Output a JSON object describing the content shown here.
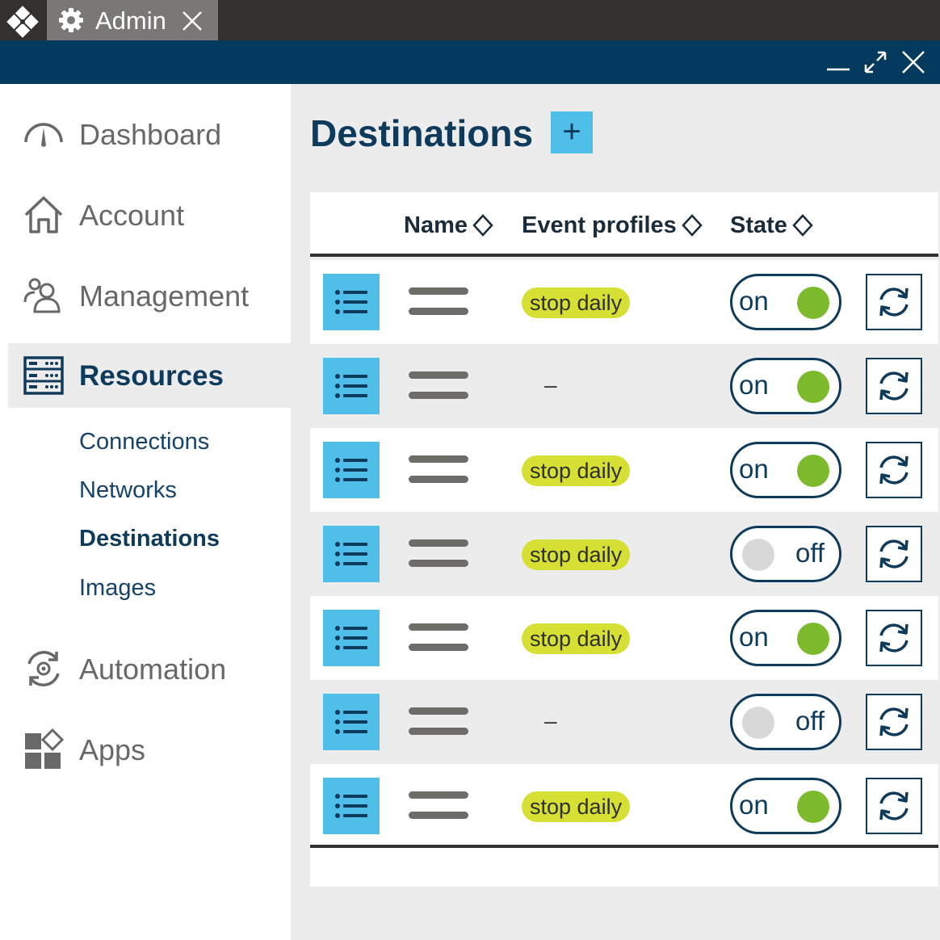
{
  "tab": {
    "label": "Admin"
  },
  "sidebar": {
    "items": [
      {
        "label": "Dashboard",
        "icon": "gauge-icon"
      },
      {
        "label": "Account",
        "icon": "house-icon"
      },
      {
        "label": "Management",
        "icon": "users-icon"
      },
      {
        "label": "Resources",
        "icon": "server-icon",
        "active": true
      },
      {
        "label": "Automation",
        "icon": "gear-cycle-icon"
      },
      {
        "label": "Apps",
        "icon": "apps-icon"
      }
    ],
    "subitems": [
      {
        "label": "Connections"
      },
      {
        "label": "Networks"
      },
      {
        "label": "Destinations",
        "current": true
      },
      {
        "label": "Images"
      }
    ]
  },
  "main": {
    "title": "Destinations",
    "add_button": "+",
    "columns": {
      "name": "Name",
      "event_profiles": "Event profiles",
      "state": "State"
    },
    "rows": [
      {
        "event_profile": "stop daily",
        "state": "on"
      },
      {
        "event_profile": "–",
        "state": "on"
      },
      {
        "event_profile": "stop daily",
        "state": "on"
      },
      {
        "event_profile": "stop daily",
        "state": "off"
      },
      {
        "event_profile": "stop daily",
        "state": "on"
      },
      {
        "event_profile": "–",
        "state": "off"
      },
      {
        "event_profile": "stop daily",
        "state": "on"
      }
    ]
  },
  "colors": {
    "tabbar": "#33302d",
    "titlebar": "#053a5f",
    "accent": "#4fbee9",
    "navy": "#0e3a5b",
    "badge": "#d6df33",
    "on_knob": "#7dbb2c",
    "off_knob": "#d8d8d8"
  }
}
